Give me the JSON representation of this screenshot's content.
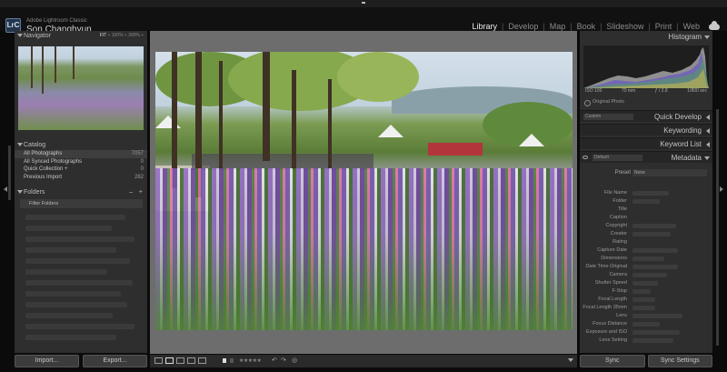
{
  "identity": {
    "app_name": "Adobe Lightroom Classic",
    "user_name": "Son Changhyun",
    "logo": "LrC"
  },
  "modules": [
    "Library",
    "Develop",
    "Map",
    "Book",
    "Slideshow",
    "Print",
    "Web"
  ],
  "active_module": "Library",
  "navigator": {
    "title": "Navigator",
    "zoom_fit": "FIT",
    "zoom_100": "100%",
    "zoom_300": "300%"
  },
  "catalog": {
    "title": "Catalog",
    "items": [
      {
        "label": "All Photographs",
        "count": "7057"
      },
      {
        "label": "All Synced Photographs",
        "count": "0"
      },
      {
        "label": "Quick Collection +",
        "count": "0"
      },
      {
        "label": "Previous Import",
        "count": "282"
      }
    ]
  },
  "folders": {
    "title": "Folders",
    "add": "+",
    "remove": "–",
    "filter": "Filter Folders"
  },
  "left_buttons": {
    "import": "Import...",
    "export": "Export..."
  },
  "toolbar": {
    "stars": "★★★★★"
  },
  "histogram": {
    "title": "Histogram",
    "iso": "ISO 100",
    "focal": "70 mm",
    "aperture": "ƒ / 2.8",
    "shutter": "1/800 sec",
    "original_photo": "Original Photo"
  },
  "quick_develop": {
    "title": "Quick Develop",
    "preset": "Custom"
  },
  "keywording": {
    "title": "Keywording"
  },
  "keyword_list": {
    "title": "Keyword List"
  },
  "metadata": {
    "title": "Metadata",
    "preset_menu": "Default",
    "preset_label": "Preset",
    "preset_value": "None",
    "fields": [
      "File Name",
      "Folder",
      "Title",
      "Caption",
      "Copyright",
      "Creator",
      "Rating",
      "Capture Date",
      "Dimensions",
      "Date Time Original",
      "Camera",
      "Shutter Speed",
      "F-Stop",
      "Focal Length",
      "Focal Length 35mm",
      "Lens",
      "Focus Distance",
      "Exposure and ISO",
      "Lens Setting"
    ]
  },
  "right_buttons": {
    "sync": "Sync",
    "sync_settings": "Sync Settings"
  }
}
